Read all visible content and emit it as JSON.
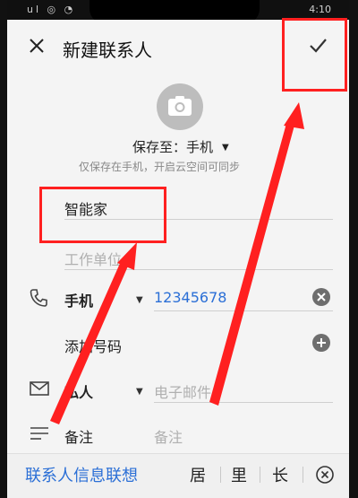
{
  "status": {
    "left": "ul ◎ ◔",
    "time": "4:10"
  },
  "header": {
    "title": "新建联系人"
  },
  "save": {
    "label": "保存至：手机",
    "hint": "仅保存在手机，开启云空间可同步"
  },
  "form": {
    "name_value": "智能家",
    "company_placeholder": "工作单位",
    "phone_type": "手机",
    "phone_value": "12345678",
    "add_phone": "添加号码",
    "email_type": "私人",
    "email_placeholder": "电子邮件",
    "note_label": "备注",
    "note_placeholder": "备注"
  },
  "keyboard": {
    "suggestion": "联系人信息联想",
    "words": [
      "居",
      "里",
      "长"
    ]
  },
  "colors": {
    "accent": "#2b6fd6",
    "annotation": "#ff2020"
  }
}
